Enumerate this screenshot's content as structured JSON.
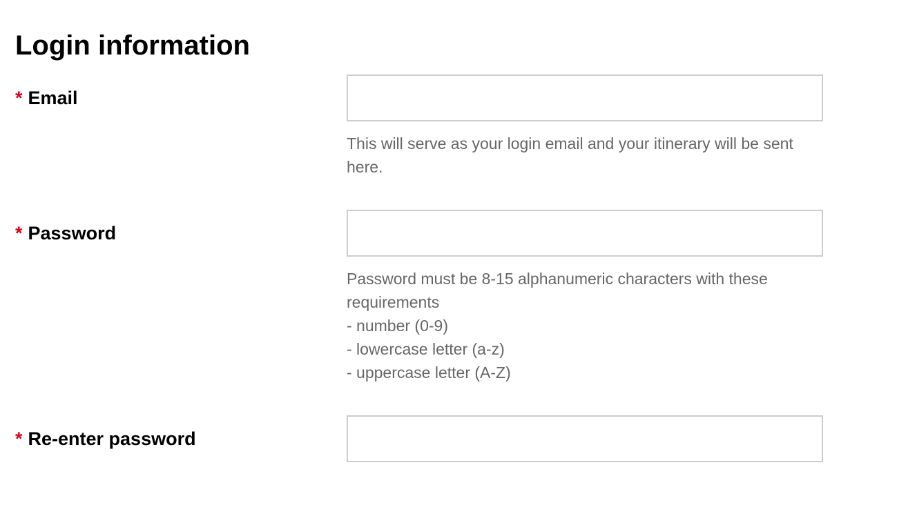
{
  "section": {
    "title": "Login information"
  },
  "colors": {
    "required": "#e0001b",
    "input_border": "#cccccc",
    "help_text": "#666666"
  },
  "fields": {
    "email": {
      "required_mark": "*",
      "label": "Email",
      "value": "",
      "help": "This will serve as your login email and your itinerary will be sent here."
    },
    "password": {
      "required_mark": "*",
      "label": "Password",
      "value": "",
      "help_intro": "Password must be 8-15 alphanumeric characters with these requirements",
      "requirements": [
        "- number (0-9)",
        "- lowercase letter (a-z)",
        "- uppercase letter (A-Z)"
      ]
    },
    "reenter_password": {
      "required_mark": "*",
      "label": "Re-enter password",
      "value": ""
    }
  }
}
